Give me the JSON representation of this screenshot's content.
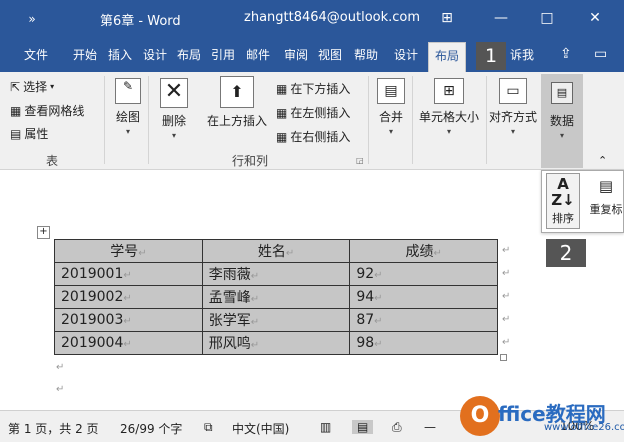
{
  "titlebar": {
    "qat": "»",
    "doc_title": "第6章  -  Word",
    "account": "zhangtt8464@outlook.com",
    "ribbon_display": "⊞",
    "minimize": "—",
    "maximize": "□",
    "close": "✕"
  },
  "tabs": {
    "items": [
      "文件",
      "开始",
      "插入",
      "设计",
      "布局",
      "引用",
      "邮件",
      "审阅",
      "视图",
      "帮助",
      "设计",
      "布局"
    ],
    "active": "布局",
    "tell_me": "诉我",
    "share_icon": "share-icon",
    "comments_icon": "comments-icon"
  },
  "callouts": {
    "step1": "1",
    "step2": "2"
  },
  "ribbon": {
    "select": "选择",
    "view_gridlines": "查看网格线",
    "properties": "属性",
    "group_table": "表",
    "draw": "绘图",
    "delete": "删除",
    "insert_above": "在上方插入",
    "insert_below": "在下方插入",
    "insert_left": "在左侧插入",
    "insert_right": "在右侧插入",
    "group_rows_cols": "行和列",
    "merge": "合并",
    "cell_size": "单元格大小",
    "alignment": "对齐方式",
    "data": "数据"
  },
  "dropdown": {
    "sort_glyph_top": "A",
    "sort_glyph_bottom": "Z↓",
    "sort": "排序",
    "repeat_header": "重复标"
  },
  "table": {
    "headers": [
      "学号",
      "姓名",
      "成绩"
    ],
    "rows": [
      [
        "2019001",
        "李雨薇",
        "92"
      ],
      [
        "2019002",
        "孟雪峰",
        "94"
      ],
      [
        "2019003",
        "张学军",
        "87"
      ],
      [
        "2019004",
        "邢风鸣",
        "98"
      ]
    ]
  },
  "statusbar": {
    "page": "第 1 页，共 2 页",
    "words": "26/99 个字",
    "language": "中文(中国)",
    "zoom": "100%"
  },
  "watermark": {
    "logo_letter": "O",
    "text": "ffice教程网",
    "url": "www.office26.com"
  },
  "colors": {
    "title_bg": "#2b579a",
    "cell_fill": "#c6c6c6",
    "callout_bg": "#555555"
  }
}
